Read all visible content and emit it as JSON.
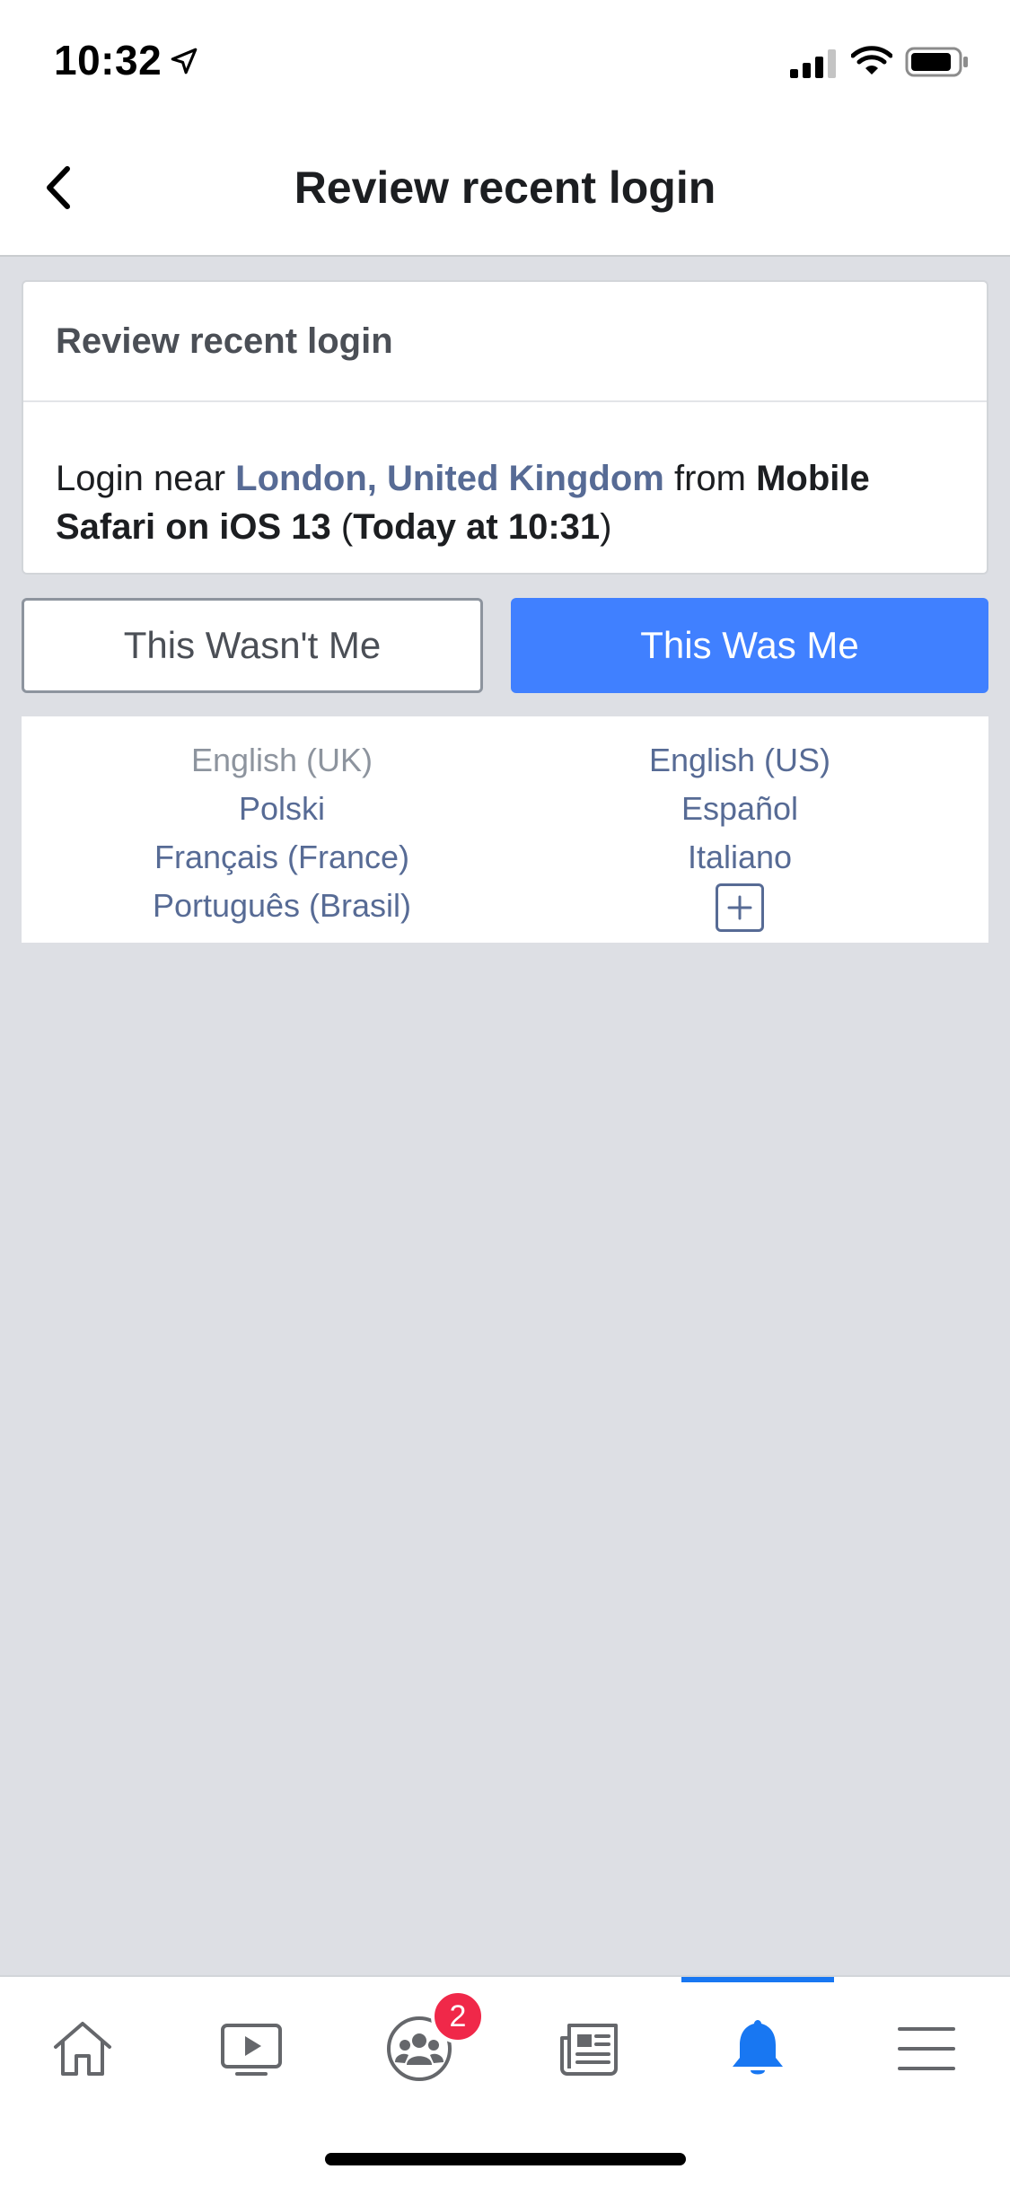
{
  "status_bar": {
    "time": "10:32",
    "icons": [
      "location-arrow-icon",
      "cellular-signal-icon",
      "wifi-icon",
      "battery-icon"
    ]
  },
  "header": {
    "title": "Review recent login",
    "back_icon": "chevron-left-icon"
  },
  "card": {
    "title": "Review recent login",
    "prefix": "Login near ",
    "location": "London, United Kingdom",
    "middle": " from ",
    "device": "Mobile Safari on iOS 13",
    "open_paren": " (",
    "time": "Today at 10:31",
    "close_paren": ")"
  },
  "actions": {
    "wasnt_me": "This Wasn't Me",
    "was_me": "This Was Me"
  },
  "languages": {
    "left": [
      "English (UK)",
      "Polski",
      "Français (France)",
      "Português (Brasil)"
    ],
    "right": [
      "English (US)",
      "Español",
      "Italiano"
    ],
    "current": "English (UK)",
    "more_icon": "plus-icon"
  },
  "tab_bar": {
    "tabs": [
      "home-icon",
      "video-icon",
      "groups-icon",
      "news-icon",
      "notifications-icon",
      "menu-icon"
    ],
    "active": "notifications-icon",
    "groups_badge": "2"
  },
  "colors": {
    "primary_blue": "#4080ff",
    "link_blue": "#576b95",
    "active_tab": "#1877f2",
    "badge_red": "#f02849",
    "background": "#dddfe4"
  }
}
